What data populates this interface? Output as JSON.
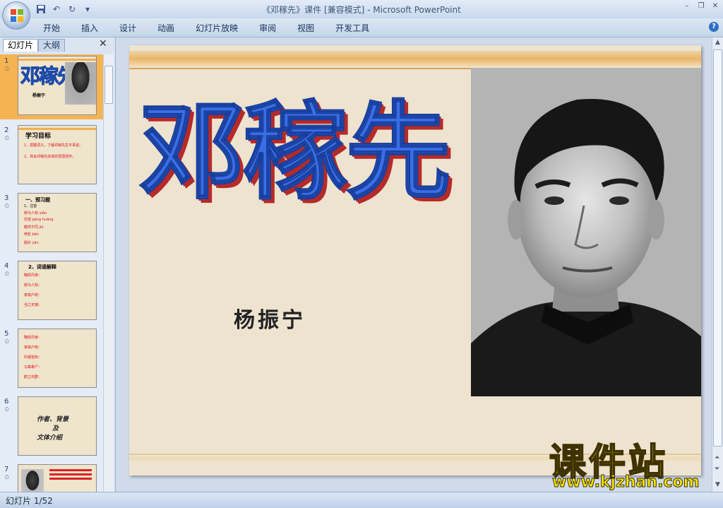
{
  "window": {
    "title": "《邓稼先》课件 [兼容模式] - Microsoft PowerPoint"
  },
  "ribbon": {
    "tabs": [
      {
        "label": "开始"
      },
      {
        "label": "插入"
      },
      {
        "label": "设计"
      },
      {
        "label": "动画"
      },
      {
        "label": "幻灯片放映"
      },
      {
        "label": "审阅"
      },
      {
        "label": "视图"
      },
      {
        "label": "开发工具"
      }
    ]
  },
  "panel": {
    "tab_slides": "幻灯片",
    "tab_outline": "大纲",
    "thumbnails": [
      {
        "num": "1",
        "title": "邓稼先",
        "lines": [
          "杨振宁"
        ]
      },
      {
        "num": "2",
        "title": "学习目标",
        "lines": [
          "1、把握词义，了解邓稼先生平事迹。",
          "2、体会邓稼先崇高的爱国情怀。"
        ]
      },
      {
        "num": "3",
        "title": "一、预习题",
        "lines": [
          "1、注音",
          "鲜为人知 xiǎn",
          "彷徨 páng huáng",
          "截然不同 jié",
          "奔赴 bēn",
          "殷红 yān"
        ]
      },
      {
        "num": "4",
        "title": "2、词语解释",
        "lines": [
          "鞠躬尽瘁：",
          "鲜为人知：",
          "家喻户晓：",
          "当之无愧："
        ]
      },
      {
        "num": "5",
        "title": "",
        "lines": [
          "鞠躬尽瘁：",
          "家喻户晓：",
          "妇孺皆知：",
          "马革裹尸：",
          "鹤立鸡群："
        ]
      },
      {
        "num": "6",
        "title": "作者、背景",
        "lines": [
          "及",
          "文体介绍"
        ]
      },
      {
        "num": "7",
        "title": "",
        "lines": []
      }
    ]
  },
  "slide": {
    "title": "邓稼先",
    "author": "杨振宁"
  },
  "status": {
    "slide_counter": "幻灯片 1/52"
  },
  "watermark": {
    "name": "课件站",
    "url": "www.kjzhan.com"
  },
  "colors": {
    "title_fill": "#3a6ee6",
    "title_shadow": "#b52a2a",
    "slide_bg": "#ede3cf",
    "band": "#e9b56a",
    "selected_thumb": "#f6b351",
    "watermark": "#f7e400"
  }
}
